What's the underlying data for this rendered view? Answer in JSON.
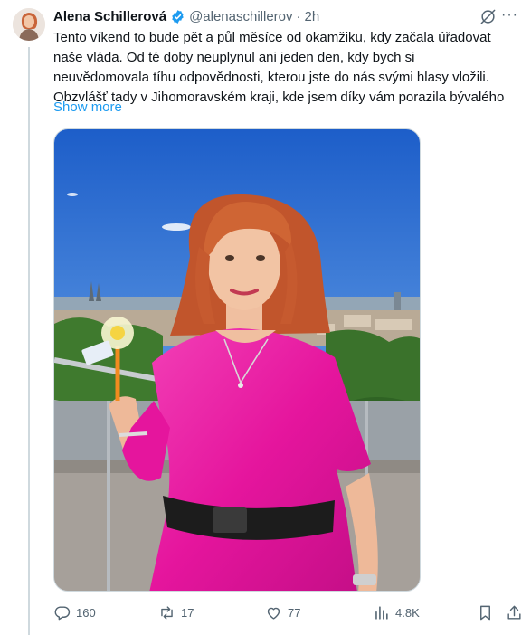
{
  "tweet": {
    "author_name": "Alena Schillerová",
    "handle": "@alenaschillerov",
    "separator": "·",
    "time": "2h",
    "text_lines": [
      "Tento víkend to bude pět a půl měsíce od okamžiku, kdy začala úřadovat",
      "naše vláda. Od té doby neuplynul ani jeden den, kdy bych si",
      "neuvědomovala tíhu odpovědnosti, kterou jste do nás svými hlasy vložili.",
      "Obzvlášť tady v Jihomoravském kraji, kde jsem díky vám porazila bývalého"
    ],
    "show_more": "Show more"
  },
  "actions": {
    "replies": "160",
    "reposts": "17",
    "likes": "77",
    "views": "4.8K"
  },
  "colors": {
    "accent": "#1d9bf0",
    "secondary_text": "#536471",
    "dress": "#e5159d"
  },
  "icons": [
    "verified-badge-icon",
    "grok-icon",
    "more-icon",
    "reply-icon",
    "repost-icon",
    "like-icon",
    "views-icon",
    "bookmark-icon",
    "share-icon"
  ]
}
